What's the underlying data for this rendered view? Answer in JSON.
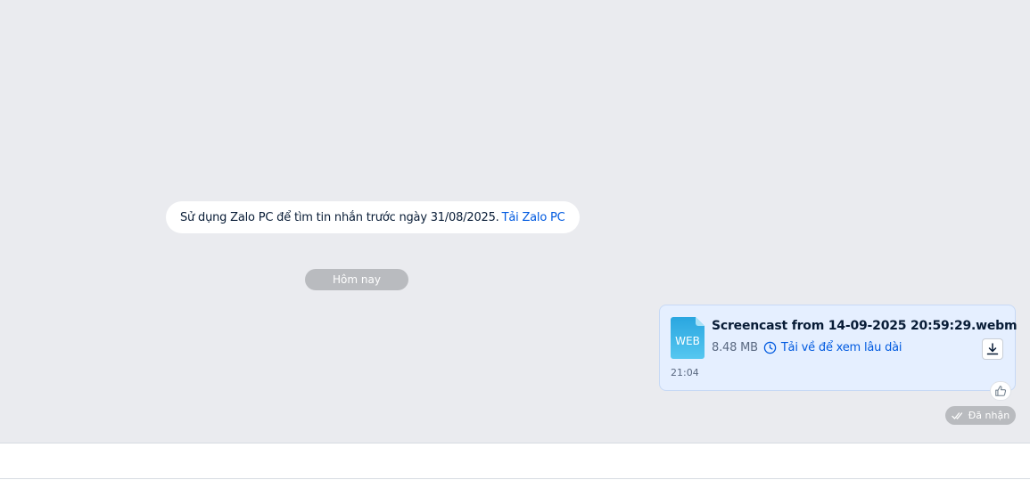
{
  "notice": {
    "text": "Sử dụng Zalo PC để tìm tin nhắn trước ngày 31/08/2025.",
    "link_label": "Tải Zalo PC"
  },
  "date_separator": "Hôm nay",
  "message": {
    "file_type_label": "WEB",
    "file_name": "Screencast from 14-09-2025 20:59:29.webm",
    "file_size": "8.48 MB",
    "download_hint": "Tải về để xem lâu dài",
    "time": "21:04",
    "status": "Đã nhận"
  },
  "icons": {
    "file": "webm-file-icon",
    "clock": "clock-icon",
    "download": "download-icon",
    "reaction": "thumbs-up-icon",
    "status": "double-check-icon"
  },
  "colors": {
    "chat_background": "#eaebef",
    "link": "#005ae0",
    "bubble_background": "#e5efff",
    "pill_background": "#b9bbbf",
    "file_icon": "#3bb4e6"
  }
}
